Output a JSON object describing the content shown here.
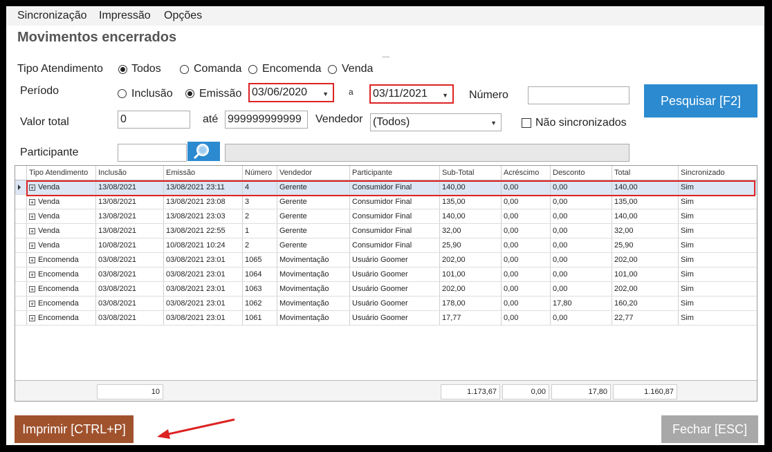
{
  "menu": [
    "Sincronização",
    "Impressão",
    "Opções"
  ],
  "title": "Movimentos encerrados",
  "dots": "......",
  "tipo_atendimento": {
    "label": "Tipo Atendimento",
    "options": [
      "Todos",
      "Comanda",
      "Encomenda",
      "Venda"
    ],
    "selected": "Todos"
  },
  "periodo": {
    "label": "Período",
    "options": [
      "Inclusão",
      "Emissão"
    ],
    "selected": "Emissão",
    "date_from": "03/06/2020",
    "separator": "a",
    "date_to": "03/11/2021"
  },
  "numero": {
    "label": "Número",
    "value": ""
  },
  "search_button": "Pesquisar [F2]",
  "valor_total": {
    "label": "Valor total",
    "from": "0",
    "separator": "até",
    "to": "999999999999"
  },
  "vendedor": {
    "label": "Vendedor",
    "value": "(Todos)"
  },
  "nao_sincronizados": {
    "label": "Não sincronizados",
    "checked": false
  },
  "participante": {
    "label": "Participante",
    "value": "",
    "desc": ""
  },
  "grid": {
    "columns": [
      "Tipo Atendimento",
      "Inclusão",
      "Emissão",
      "Número",
      "Vendedor",
      "Participante",
      "Sub-Total",
      "Acréscimo",
      "Desconto",
      "Total",
      "Sincronizado"
    ],
    "rows": [
      [
        "Venda",
        "13/08/2021",
        "13/08/2021 23:11",
        "4",
        "Gerente",
        "Consumidor Final",
        "140,00",
        "0,00",
        "0,00",
        "140,00",
        "Sim"
      ],
      [
        "Venda",
        "13/08/2021",
        "13/08/2021 23:08",
        "3",
        "Gerente",
        "Consumidor Final",
        "135,00",
        "0,00",
        "0,00",
        "135,00",
        "Sim"
      ],
      [
        "Venda",
        "13/08/2021",
        "13/08/2021 23:03",
        "2",
        "Gerente",
        "Consumidor Final",
        "140,00",
        "0,00",
        "0,00",
        "140,00",
        "Sim"
      ],
      [
        "Venda",
        "13/08/2021",
        "13/08/2021 22:55",
        "1",
        "Gerente",
        "Consumidor Final",
        "32,00",
        "0,00",
        "0,00",
        "32,00",
        "Sim"
      ],
      [
        "Venda",
        "10/08/2021",
        "10/08/2021 10:24",
        "2",
        "Gerente",
        "Consumidor Final",
        "25,90",
        "0,00",
        "0,00",
        "25,90",
        "Sim"
      ],
      [
        "Encomenda",
        "03/08/2021",
        "03/08/2021 23:01",
        "1065",
        "Movimentação",
        "Usuário Goomer",
        "202,00",
        "0,00",
        "0,00",
        "202,00",
        "Sim"
      ],
      [
        "Encomenda",
        "03/08/2021",
        "03/08/2021 23:01",
        "1064",
        "Movimentação",
        "Usuário Goomer",
        "101,00",
        "0,00",
        "0,00",
        "101,00",
        "Sim"
      ],
      [
        "Encomenda",
        "03/08/2021",
        "03/08/2021 23:01",
        "1063",
        "Movimentação",
        "Usuário Goomer",
        "202,00",
        "0,00",
        "0,00",
        "202,00",
        "Sim"
      ],
      [
        "Encomenda",
        "03/08/2021",
        "03/08/2021 23:01",
        "1062",
        "Movimentação",
        "Usuário Goomer",
        "178,00",
        "0,00",
        "17,80",
        "160,20",
        "Sim"
      ],
      [
        "Encomenda",
        "03/08/2021",
        "03/08/2021 23:01",
        "1061",
        "Movimentação",
        "Usuário Goomer",
        "17,77",
        "0,00",
        "0,00",
        "22,77",
        "Sim"
      ]
    ],
    "selected_row": 0,
    "footer": {
      "count": "10",
      "subtotal": "1.173,67",
      "acrescimo": "0,00",
      "desconto": "17,80",
      "total": "1.160,87"
    }
  },
  "print_button": "Imprimir [CTRL+P]",
  "close_button": "Fechar [ESC]",
  "colors": {
    "search_button": "#2b8ad0",
    "print_button": "#a0522d",
    "close_button": "#a8a8a8",
    "highlight": "#d22222"
  },
  "icons": {
    "search": "magnifier-icon",
    "arrow": "red-arrow-annotation"
  }
}
